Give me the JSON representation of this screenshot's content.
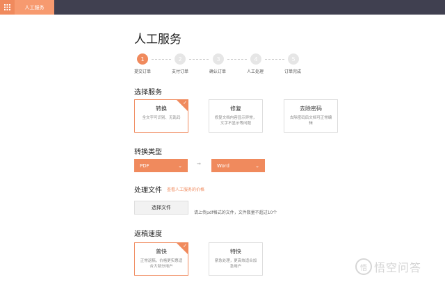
{
  "topbar": {
    "menu_icon": "grid-icon",
    "tab_label": "人工服务",
    "accent": "#f08a5d",
    "bar_color": "#404050"
  },
  "page": {
    "title": "人工服务"
  },
  "steps": [
    {
      "num": "1",
      "label": "提交订单",
      "active": true
    },
    {
      "num": "2",
      "label": "支付订单",
      "active": false
    },
    {
      "num": "3",
      "label": "确认订单",
      "active": false
    },
    {
      "num": "4",
      "label": "人工处理",
      "active": false
    },
    {
      "num": "5",
      "label": "订单完成",
      "active": false
    }
  ],
  "service": {
    "title": "选择服务",
    "options": [
      {
        "title": "转换",
        "desc": "全文字可识别、无乱码",
        "selected": true
      },
      {
        "title": "修复",
        "desc": "修复文档内容显示异常，文字不显示等问题",
        "selected": false
      },
      {
        "title": "去除密码",
        "desc": "去除密码后文档可正常编辑",
        "selected": false
      }
    ]
  },
  "convert": {
    "title": "转换类型",
    "from": "PDF",
    "separator": "→",
    "to": "Word"
  },
  "file": {
    "title": "处理文件",
    "link": "查看人工服务的价格",
    "button": "选择文件",
    "hint": "请上传pdf格式的文件，文件数量不超过10个"
  },
  "speed": {
    "title": "返稿速度",
    "options": [
      {
        "title": "普快",
        "desc": "正常返稿，价格更实惠适合大部分用户",
        "selected": true
      },
      {
        "title": "特快",
        "desc": "紧急处理，更高效适合加急用户",
        "selected": false
      }
    ]
  },
  "watermark": {
    "logo": "悟",
    "text": "悟空问答"
  }
}
